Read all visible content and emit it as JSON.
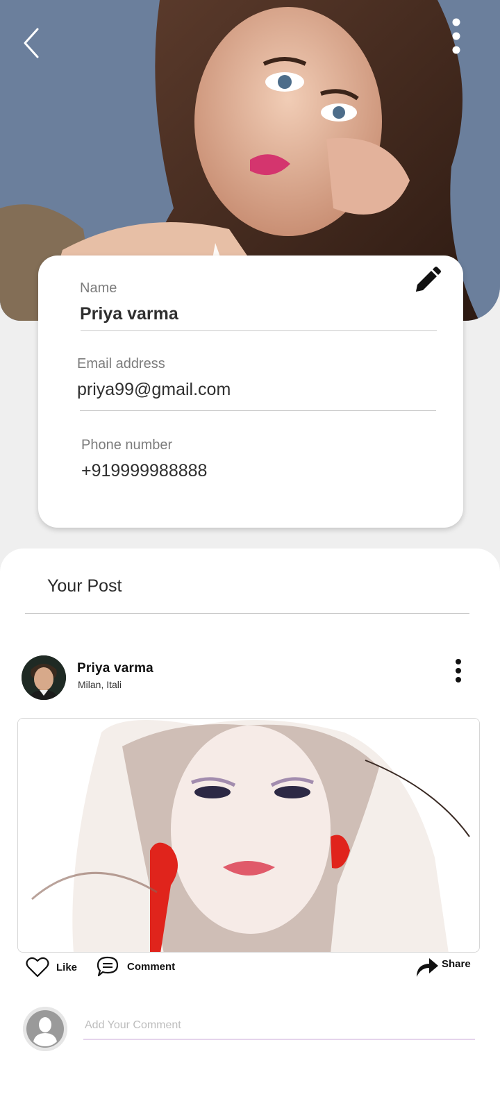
{
  "profile": {
    "name_label": "Name",
    "name_value": "Priya varma",
    "email_label": "Email address",
    "email_value": "priya99@gmail.com",
    "phone_label": "Phone number",
    "phone_value": "+919999988888"
  },
  "icons": {
    "back": "back-arrow-icon",
    "more": "more-vertical-icon",
    "edit": "pencil-icon",
    "like": "heart-icon",
    "comment": "comment-icon",
    "share": "share-icon"
  },
  "posts": {
    "title": "Your Post",
    "items": [
      {
        "author": "Priya varma",
        "location": "Milan, Itali",
        "actions": {
          "like": "Like",
          "comment": "Comment",
          "share": "Share"
        }
      }
    ]
  },
  "comment": {
    "placeholder": "Add Your Comment"
  },
  "colors": {
    "accent": "#e5d4ec",
    "hero_bg": "#6f84a0",
    "text": "#2f2f2f"
  }
}
